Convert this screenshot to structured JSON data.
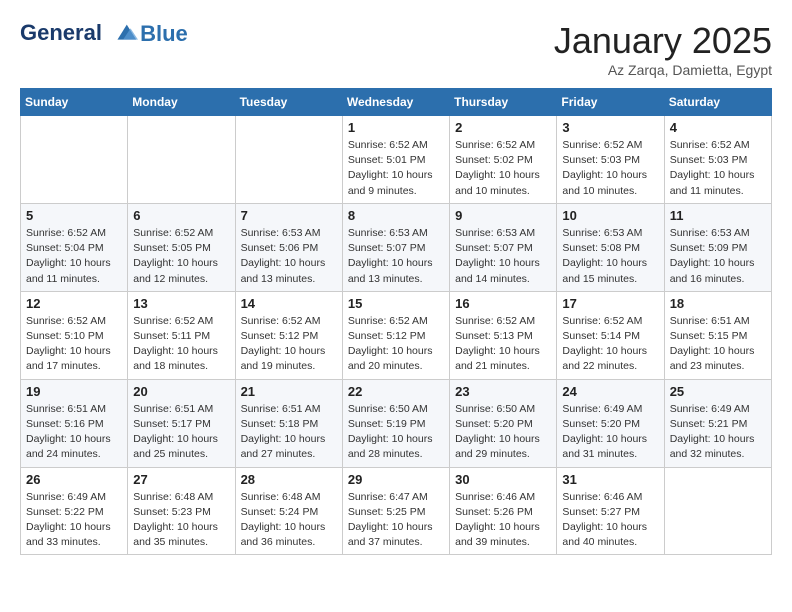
{
  "header": {
    "logo_line1": "General",
    "logo_line2": "Blue",
    "month_title": "January 2025",
    "subtitle": "Az Zarqa, Damietta, Egypt"
  },
  "weekdays": [
    "Sunday",
    "Monday",
    "Tuesday",
    "Wednesday",
    "Thursday",
    "Friday",
    "Saturday"
  ],
  "weeks": [
    [
      {
        "day": "",
        "info": ""
      },
      {
        "day": "",
        "info": ""
      },
      {
        "day": "",
        "info": ""
      },
      {
        "day": "1",
        "info": "Sunrise: 6:52 AM\nSunset: 5:01 PM\nDaylight: 10 hours\nand 9 minutes."
      },
      {
        "day": "2",
        "info": "Sunrise: 6:52 AM\nSunset: 5:02 PM\nDaylight: 10 hours\nand 10 minutes."
      },
      {
        "day": "3",
        "info": "Sunrise: 6:52 AM\nSunset: 5:03 PM\nDaylight: 10 hours\nand 10 minutes."
      },
      {
        "day": "4",
        "info": "Sunrise: 6:52 AM\nSunset: 5:03 PM\nDaylight: 10 hours\nand 11 minutes."
      }
    ],
    [
      {
        "day": "5",
        "info": "Sunrise: 6:52 AM\nSunset: 5:04 PM\nDaylight: 10 hours\nand 11 minutes."
      },
      {
        "day": "6",
        "info": "Sunrise: 6:52 AM\nSunset: 5:05 PM\nDaylight: 10 hours\nand 12 minutes."
      },
      {
        "day": "7",
        "info": "Sunrise: 6:53 AM\nSunset: 5:06 PM\nDaylight: 10 hours\nand 13 minutes."
      },
      {
        "day": "8",
        "info": "Sunrise: 6:53 AM\nSunset: 5:07 PM\nDaylight: 10 hours\nand 13 minutes."
      },
      {
        "day": "9",
        "info": "Sunrise: 6:53 AM\nSunset: 5:07 PM\nDaylight: 10 hours\nand 14 minutes."
      },
      {
        "day": "10",
        "info": "Sunrise: 6:53 AM\nSunset: 5:08 PM\nDaylight: 10 hours\nand 15 minutes."
      },
      {
        "day": "11",
        "info": "Sunrise: 6:53 AM\nSunset: 5:09 PM\nDaylight: 10 hours\nand 16 minutes."
      }
    ],
    [
      {
        "day": "12",
        "info": "Sunrise: 6:52 AM\nSunset: 5:10 PM\nDaylight: 10 hours\nand 17 minutes."
      },
      {
        "day": "13",
        "info": "Sunrise: 6:52 AM\nSunset: 5:11 PM\nDaylight: 10 hours\nand 18 minutes."
      },
      {
        "day": "14",
        "info": "Sunrise: 6:52 AM\nSunset: 5:12 PM\nDaylight: 10 hours\nand 19 minutes."
      },
      {
        "day": "15",
        "info": "Sunrise: 6:52 AM\nSunset: 5:12 PM\nDaylight: 10 hours\nand 20 minutes."
      },
      {
        "day": "16",
        "info": "Sunrise: 6:52 AM\nSunset: 5:13 PM\nDaylight: 10 hours\nand 21 minutes."
      },
      {
        "day": "17",
        "info": "Sunrise: 6:52 AM\nSunset: 5:14 PM\nDaylight: 10 hours\nand 22 minutes."
      },
      {
        "day": "18",
        "info": "Sunrise: 6:51 AM\nSunset: 5:15 PM\nDaylight: 10 hours\nand 23 minutes."
      }
    ],
    [
      {
        "day": "19",
        "info": "Sunrise: 6:51 AM\nSunset: 5:16 PM\nDaylight: 10 hours\nand 24 minutes."
      },
      {
        "day": "20",
        "info": "Sunrise: 6:51 AM\nSunset: 5:17 PM\nDaylight: 10 hours\nand 25 minutes."
      },
      {
        "day": "21",
        "info": "Sunrise: 6:51 AM\nSunset: 5:18 PM\nDaylight: 10 hours\nand 27 minutes."
      },
      {
        "day": "22",
        "info": "Sunrise: 6:50 AM\nSunset: 5:19 PM\nDaylight: 10 hours\nand 28 minutes."
      },
      {
        "day": "23",
        "info": "Sunrise: 6:50 AM\nSunset: 5:20 PM\nDaylight: 10 hours\nand 29 minutes."
      },
      {
        "day": "24",
        "info": "Sunrise: 6:49 AM\nSunset: 5:20 PM\nDaylight: 10 hours\nand 31 minutes."
      },
      {
        "day": "25",
        "info": "Sunrise: 6:49 AM\nSunset: 5:21 PM\nDaylight: 10 hours\nand 32 minutes."
      }
    ],
    [
      {
        "day": "26",
        "info": "Sunrise: 6:49 AM\nSunset: 5:22 PM\nDaylight: 10 hours\nand 33 minutes."
      },
      {
        "day": "27",
        "info": "Sunrise: 6:48 AM\nSunset: 5:23 PM\nDaylight: 10 hours\nand 35 minutes."
      },
      {
        "day": "28",
        "info": "Sunrise: 6:48 AM\nSunset: 5:24 PM\nDaylight: 10 hours\nand 36 minutes."
      },
      {
        "day": "29",
        "info": "Sunrise: 6:47 AM\nSunset: 5:25 PM\nDaylight: 10 hours\nand 37 minutes."
      },
      {
        "day": "30",
        "info": "Sunrise: 6:46 AM\nSunset: 5:26 PM\nDaylight: 10 hours\nand 39 minutes."
      },
      {
        "day": "31",
        "info": "Sunrise: 6:46 AM\nSunset: 5:27 PM\nDaylight: 10 hours\nand 40 minutes."
      },
      {
        "day": "",
        "info": ""
      }
    ]
  ]
}
